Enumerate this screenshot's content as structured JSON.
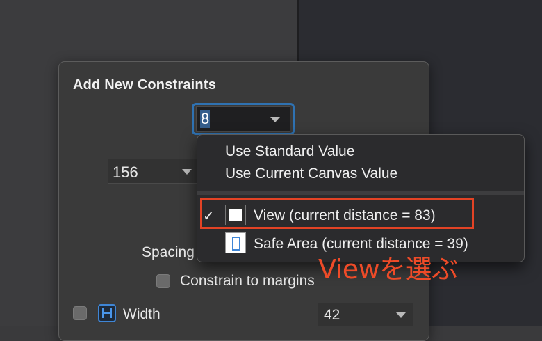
{
  "panel": {
    "title": "Add New Constraints",
    "top_value": "8",
    "left_value": "156",
    "spacing_label": "Spacing",
    "constrain_margins_label": "Constrain to margins",
    "width_label": "Width",
    "width_value": "42"
  },
  "menu": {
    "items": [
      {
        "label": "Use Standard Value"
      },
      {
        "label": "Use Current Canvas Value"
      },
      {
        "label": "View (current distance = 83)",
        "checked": true
      },
      {
        "label": "Safe Area (current distance = 39)"
      }
    ],
    "checkmark": "✓"
  },
  "annotation": {
    "text": "Viewを選ぶ",
    "color": "#ee4b28"
  },
  "colors": {
    "focus_ring": "#2f72b2",
    "highlight_box": "#e34325"
  }
}
